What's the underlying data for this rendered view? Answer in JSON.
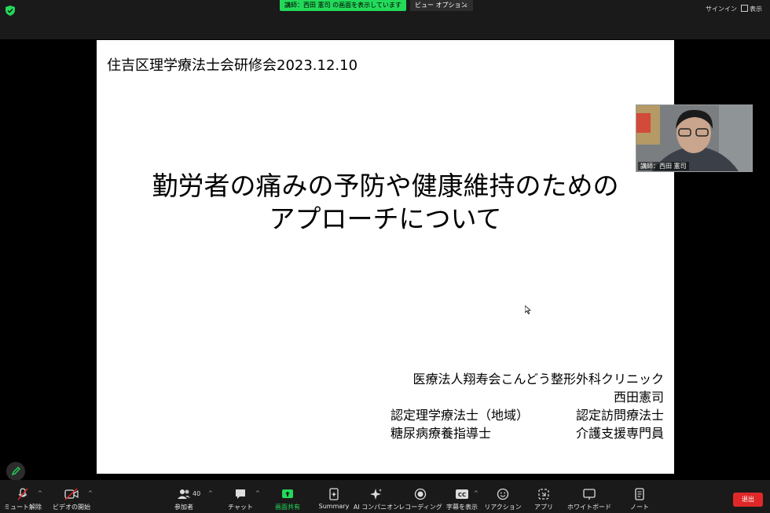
{
  "top_bar": {
    "share_banner": "講師：西田 憲司 の画面を表示しています",
    "view_options": "ビュー オプション",
    "sign_in": "サインイン",
    "view": "表示"
  },
  "slide": {
    "header": "住吉区理学療法士会研修会2023.12.10",
    "title_line1": "勤労者の痛みの予防や健康維持のための",
    "title_line2": "アプローチについて",
    "affiliation": "医療法人翔寿会こんどう整形外科クリニック",
    "presenter": "西田憲司",
    "cred1_left": "認定理学療法士（地域）",
    "cred1_right": "認定訪問療法士",
    "cred2_left": "糖尿病療養指導士",
    "cred2_right": "介護支援専門員"
  },
  "video_tile": {
    "name": "講師：西田 憲司"
  },
  "toolbar": {
    "mute": "ミュート解除",
    "video": "ビデオの開始",
    "participants": "参加者",
    "participants_count": "40",
    "chat": "チャット",
    "share": "画面共有",
    "summary": "Summary",
    "ai": "AI コンパニオン",
    "record": "レコーディング",
    "captions": "字幕を表示",
    "reactions": "リアクション",
    "apps": "アプリ",
    "whiteboard": "ホワイトボード",
    "notes": "ノート",
    "leave": "退出"
  },
  "colors": {
    "share_green": "#23d959",
    "leave_red": "#e02828",
    "toolbar_bg": "#1a1a1a"
  }
}
